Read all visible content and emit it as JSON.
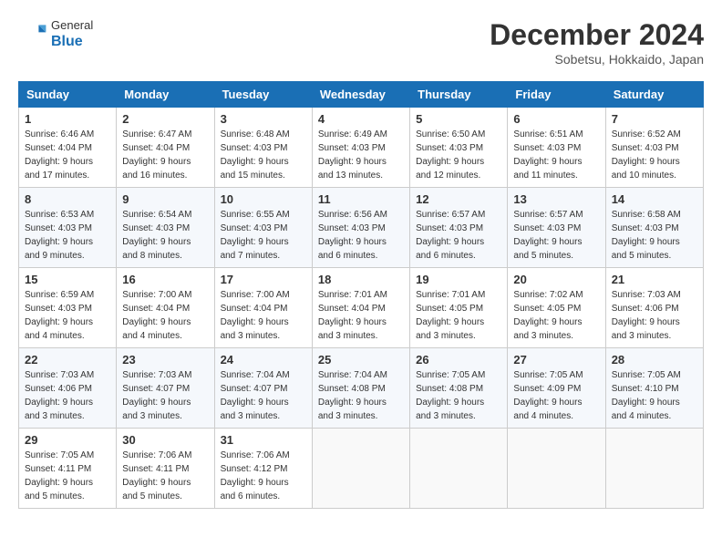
{
  "header": {
    "logo_general": "General",
    "logo_blue": "Blue",
    "month_title": "December 2024",
    "location": "Sobetsu, Hokkaido, Japan"
  },
  "weekdays": [
    "Sunday",
    "Monday",
    "Tuesday",
    "Wednesday",
    "Thursday",
    "Friday",
    "Saturday"
  ],
  "weeks": [
    [
      {
        "day": "1",
        "sunrise": "6:46 AM",
        "sunset": "4:04 PM",
        "daylight": "9 hours and 17 minutes."
      },
      {
        "day": "2",
        "sunrise": "6:47 AM",
        "sunset": "4:04 PM",
        "daylight": "9 hours and 16 minutes."
      },
      {
        "day": "3",
        "sunrise": "6:48 AM",
        "sunset": "4:03 PM",
        "daylight": "9 hours and 15 minutes."
      },
      {
        "day": "4",
        "sunrise": "6:49 AM",
        "sunset": "4:03 PM",
        "daylight": "9 hours and 13 minutes."
      },
      {
        "day": "5",
        "sunrise": "6:50 AM",
        "sunset": "4:03 PM",
        "daylight": "9 hours and 12 minutes."
      },
      {
        "day": "6",
        "sunrise": "6:51 AM",
        "sunset": "4:03 PM",
        "daylight": "9 hours and 11 minutes."
      },
      {
        "day": "7",
        "sunrise": "6:52 AM",
        "sunset": "4:03 PM",
        "daylight": "9 hours and 10 minutes."
      }
    ],
    [
      {
        "day": "8",
        "sunrise": "6:53 AM",
        "sunset": "4:03 PM",
        "daylight": "9 hours and 9 minutes."
      },
      {
        "day": "9",
        "sunrise": "6:54 AM",
        "sunset": "4:03 PM",
        "daylight": "9 hours and 8 minutes."
      },
      {
        "day": "10",
        "sunrise": "6:55 AM",
        "sunset": "4:03 PM",
        "daylight": "9 hours and 7 minutes."
      },
      {
        "day": "11",
        "sunrise": "6:56 AM",
        "sunset": "4:03 PM",
        "daylight": "9 hours and 6 minutes."
      },
      {
        "day": "12",
        "sunrise": "6:57 AM",
        "sunset": "4:03 PM",
        "daylight": "9 hours and 6 minutes."
      },
      {
        "day": "13",
        "sunrise": "6:57 AM",
        "sunset": "4:03 PM",
        "daylight": "9 hours and 5 minutes."
      },
      {
        "day": "14",
        "sunrise": "6:58 AM",
        "sunset": "4:03 PM",
        "daylight": "9 hours and 5 minutes."
      }
    ],
    [
      {
        "day": "15",
        "sunrise": "6:59 AM",
        "sunset": "4:03 PM",
        "daylight": "9 hours and 4 minutes."
      },
      {
        "day": "16",
        "sunrise": "7:00 AM",
        "sunset": "4:04 PM",
        "daylight": "9 hours and 4 minutes."
      },
      {
        "day": "17",
        "sunrise": "7:00 AM",
        "sunset": "4:04 PM",
        "daylight": "9 hours and 3 minutes."
      },
      {
        "day": "18",
        "sunrise": "7:01 AM",
        "sunset": "4:04 PM",
        "daylight": "9 hours and 3 minutes."
      },
      {
        "day": "19",
        "sunrise": "7:01 AM",
        "sunset": "4:05 PM",
        "daylight": "9 hours and 3 minutes."
      },
      {
        "day": "20",
        "sunrise": "7:02 AM",
        "sunset": "4:05 PM",
        "daylight": "9 hours and 3 minutes."
      },
      {
        "day": "21",
        "sunrise": "7:03 AM",
        "sunset": "4:06 PM",
        "daylight": "9 hours and 3 minutes."
      }
    ],
    [
      {
        "day": "22",
        "sunrise": "7:03 AM",
        "sunset": "4:06 PM",
        "daylight": "9 hours and 3 minutes."
      },
      {
        "day": "23",
        "sunrise": "7:03 AM",
        "sunset": "4:07 PM",
        "daylight": "9 hours and 3 minutes."
      },
      {
        "day": "24",
        "sunrise": "7:04 AM",
        "sunset": "4:07 PM",
        "daylight": "9 hours and 3 minutes."
      },
      {
        "day": "25",
        "sunrise": "7:04 AM",
        "sunset": "4:08 PM",
        "daylight": "9 hours and 3 minutes."
      },
      {
        "day": "26",
        "sunrise": "7:05 AM",
        "sunset": "4:08 PM",
        "daylight": "9 hours and 3 minutes."
      },
      {
        "day": "27",
        "sunrise": "7:05 AM",
        "sunset": "4:09 PM",
        "daylight": "9 hours and 4 minutes."
      },
      {
        "day": "28",
        "sunrise": "7:05 AM",
        "sunset": "4:10 PM",
        "daylight": "9 hours and 4 minutes."
      }
    ],
    [
      {
        "day": "29",
        "sunrise": "7:05 AM",
        "sunset": "4:11 PM",
        "daylight": "9 hours and 5 minutes."
      },
      {
        "day": "30",
        "sunrise": "7:06 AM",
        "sunset": "4:11 PM",
        "daylight": "9 hours and 5 minutes."
      },
      {
        "day": "31",
        "sunrise": "7:06 AM",
        "sunset": "4:12 PM",
        "daylight": "9 hours and 6 minutes."
      },
      null,
      null,
      null,
      null
    ]
  ],
  "labels": {
    "sunrise": "Sunrise:",
    "sunset": "Sunset:",
    "daylight": "Daylight:"
  }
}
